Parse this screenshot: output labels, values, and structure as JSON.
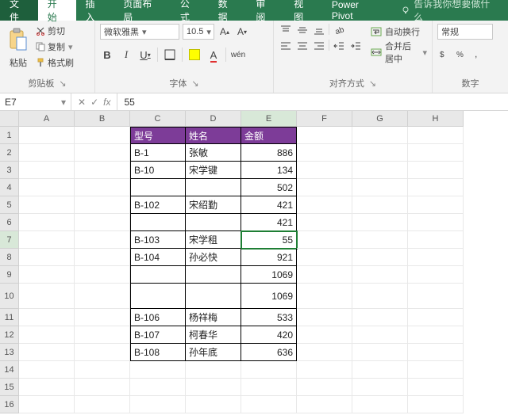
{
  "tabs": {
    "file": "文件",
    "home": "开始",
    "insert": "插入",
    "layout": "页面布局",
    "formula": "公式",
    "data": "数据",
    "review": "审阅",
    "view": "视图",
    "pivot": "Power Pivot",
    "tell": "告诉我你想要做什么"
  },
  "ribbon": {
    "clipboard": {
      "paste": "粘贴",
      "cut": "剪切",
      "copy": "复制",
      "format_painter": "格式刷",
      "label": "剪贴板"
    },
    "font": {
      "name": "微软雅黑",
      "size": "10.5",
      "label": "字体"
    },
    "align": {
      "wrap": "自动换行",
      "merge": "合并后居中",
      "label": "对齐方式"
    },
    "number": {
      "format": "常规",
      "label": "数字"
    }
  },
  "formula_bar": {
    "cell_ref": "E7",
    "value": "55"
  },
  "columns": [
    "A",
    "B",
    "C",
    "D",
    "E",
    "F",
    "G",
    "H"
  ],
  "row_ids": [
    "1",
    "2",
    "3",
    "4",
    "5",
    "6",
    "7",
    "8",
    "9",
    "10",
    "11",
    "12",
    "13",
    "14",
    "15",
    "16"
  ],
  "table": {
    "headers": {
      "c": "型号",
      "d": "姓名",
      "e": "金额"
    },
    "rows": [
      {
        "c": "B-1",
        "d": "张敏",
        "e": "886"
      },
      {
        "c": "B-10",
        "d": "宋学键",
        "e": "134"
      },
      {
        "c": "",
        "d": "",
        "e": "502"
      },
      {
        "c": "B-102",
        "d": "宋绍勤",
        "e": "421"
      },
      {
        "c": "",
        "d": "",
        "e": "421"
      },
      {
        "c": "B-103",
        "d": "宋学租",
        "e": "55"
      },
      {
        "c": "B-104",
        "d": "孙必快",
        "e": "921"
      },
      {
        "c": "",
        "d": "",
        "e": "1069"
      },
      {
        "c": "",
        "d": "",
        "e": "1069"
      },
      {
        "c": "B-106",
        "d": "杨祥梅",
        "e": "533"
      },
      {
        "c": "B-107",
        "d": "柯春华",
        "e": "420"
      },
      {
        "c": "B-108",
        "d": "孙年底",
        "e": "636"
      }
    ]
  },
  "active": {
    "row": 7,
    "col": "E"
  }
}
